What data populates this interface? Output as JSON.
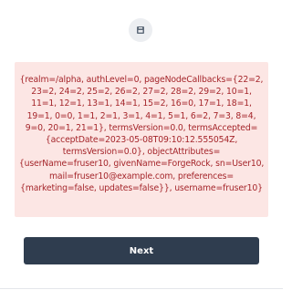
{
  "header": {
    "icon": "page-icon"
  },
  "alert": {
    "message": "{realm=/alpha, authLevel=0, pageNodeCallbacks={22=2, 23=2, 24=2, 25=2, 26=2, 27=2, 28=2, 29=2, 10=1, 11=1, 12=1, 13=1, 14=1, 15=2, 16=0, 17=1, 18=1, 19=1, 0=0, 1=1, 2=1, 3=1, 4=1, 5=1, 6=2, 7=3, 8=4, 9=0, 20=1, 21=1}, termsVersion=0.0, termsAccepted={acceptDate=2023-05-08T09:10:12.555054Z, termsVersion=0.0}, objectAttributes={userName=fruser10, givenName=ForgeRock, sn=User10, mail=fruser10@example.com, preferences={marketing=false, updates=false}}, username=fruser10}",
    "background_color": "#fce6e4",
    "text_color": "#a5262b"
  },
  "actions": {
    "next_label": "Next",
    "button_color": "#2f3d4f"
  }
}
